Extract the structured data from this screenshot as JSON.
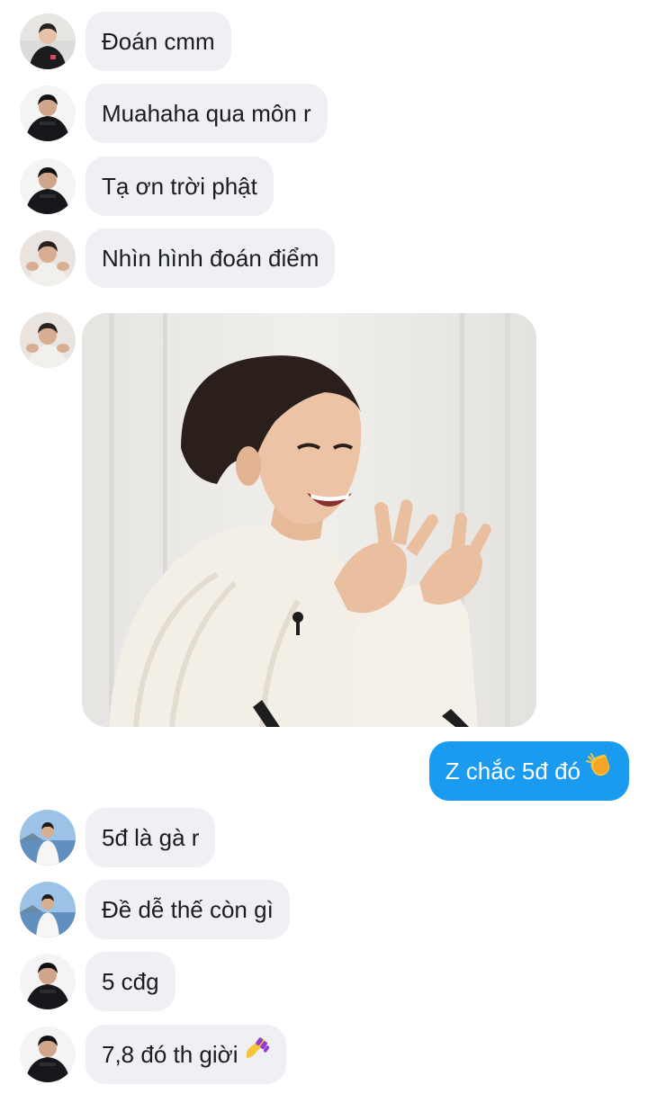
{
  "colors": {
    "incoming_bubble": "#eef0f3",
    "outgoing_bubble": "#1a9bf0",
    "incoming_text": "#1b1c1f",
    "outgoing_text": "#ffffff"
  },
  "messages": [
    {
      "sender": "contact",
      "avatar": "avatar-tshirt",
      "text": "Đoán cmm"
    },
    {
      "sender": "contact",
      "avatar": "avatar-dark",
      "text": "Muahaha qua môn r"
    },
    {
      "sender": "contact",
      "avatar": "avatar-dark",
      "text": "Tạ ơn trời phật"
    },
    {
      "sender": "contact",
      "avatar": "avatar-smile",
      "text": "Nhìn hình đoán điểm"
    },
    {
      "sender": "contact",
      "avatar": "avatar-smile",
      "type": "image",
      "image": "laughing-man-photo"
    },
    {
      "sender": "me",
      "text": "Z chắc 5đ đó",
      "emoji": "clapping-hands-emoji"
    },
    {
      "sender": "contact",
      "avatar": "avatar-beach",
      "text": "5đ là gà r"
    },
    {
      "sender": "contact",
      "avatar": "avatar-beach",
      "text": "Đề dễ thế còn gì"
    },
    {
      "sender": "contact",
      "avatar": "avatar-dark",
      "text": "5 cđg"
    },
    {
      "sender": "contact",
      "avatar": "avatar-dark",
      "text": "7,8 đó th giời",
      "emoji": "nail-polish-emoji"
    }
  ]
}
